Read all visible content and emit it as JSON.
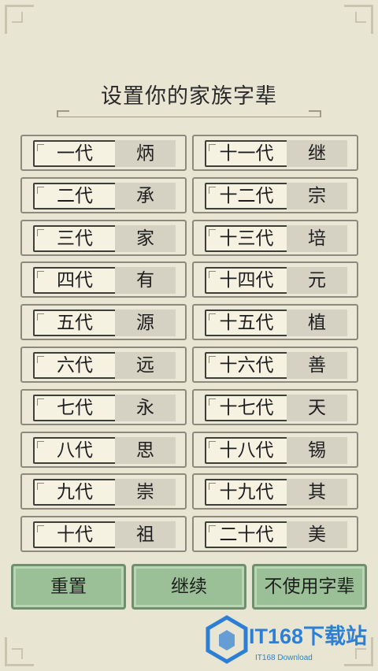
{
  "title": "设置你的家族字辈",
  "generations_left": [
    {
      "gen": "一代",
      "char": "炳"
    },
    {
      "gen": "二代",
      "char": "承"
    },
    {
      "gen": "三代",
      "char": "家"
    },
    {
      "gen": "四代",
      "char": "有"
    },
    {
      "gen": "五代",
      "char": "源"
    },
    {
      "gen": "六代",
      "char": "远"
    },
    {
      "gen": "七代",
      "char": "永"
    },
    {
      "gen": "八代",
      "char": "思"
    },
    {
      "gen": "九代",
      "char": "崇"
    },
    {
      "gen": "十代",
      "char": "祖"
    }
  ],
  "generations_right": [
    {
      "gen": "十一代",
      "char": "继"
    },
    {
      "gen": "十二代",
      "char": "宗"
    },
    {
      "gen": "十三代",
      "char": "培"
    },
    {
      "gen": "十四代",
      "char": "元"
    },
    {
      "gen": "十五代",
      "char": "植"
    },
    {
      "gen": "十六代",
      "char": "善"
    },
    {
      "gen": "十七代",
      "char": "天"
    },
    {
      "gen": "十八代",
      "char": "锡"
    },
    {
      "gen": "十九代",
      "char": "其"
    },
    {
      "gen": "二十代",
      "char": "美"
    }
  ],
  "buttons": {
    "reset": "重置",
    "continue": "继续",
    "no_use": "不使用字辈"
  },
  "watermark": {
    "main": "IT168下载站",
    "sub": "IT168 Download",
    "color": "#2d7fd6"
  },
  "colors": {
    "background": "#e9e5d3",
    "button": "#9bc098"
  }
}
